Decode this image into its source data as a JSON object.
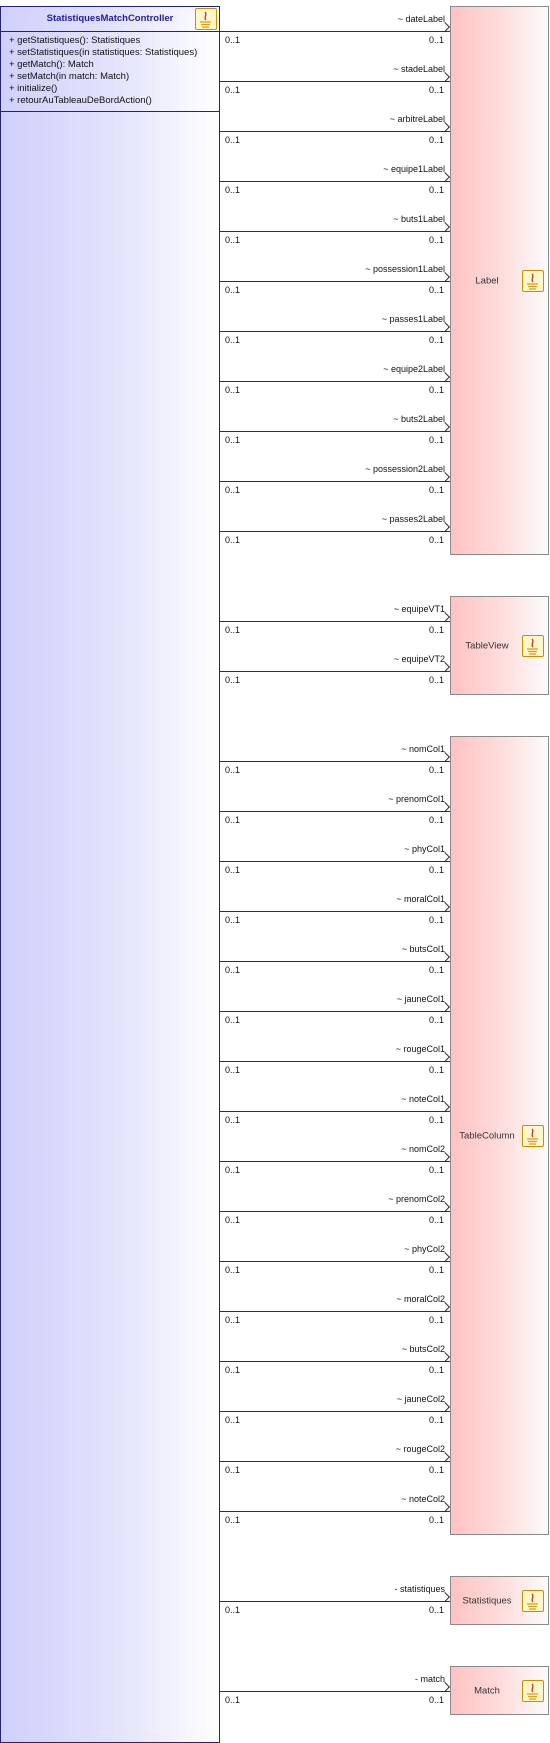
{
  "source_class": {
    "name": "StatistiquesMatchController",
    "methods": [
      "+ getStatistiques(): Statistiques",
      "+ setStatistiques(in statistiques: Statistiques)",
      "+ getMatch(): Match",
      "+ setMatch(in match: Match)",
      "+ initialize()",
      "+ retourAuTableauDeBordAction()"
    ],
    "icon": "java-class-icon"
  },
  "target_classes": [
    {
      "name": "Label",
      "icon": "java-class-icon"
    },
    {
      "name": "TableView",
      "icon": "java-class-icon"
    },
    {
      "name": "TableColumn",
      "icon": "java-class-icon"
    },
    {
      "name": "Statistiques",
      "icon": "java-class-icon"
    },
    {
      "name": "Match",
      "icon": "java-class-icon"
    }
  ],
  "associations": [
    {
      "role": "~ dateLabel",
      "source_mult": "0..1",
      "target_mult": "0..1",
      "target": "Label"
    },
    {
      "role": "~ stadeLabel",
      "source_mult": "0..1",
      "target_mult": "0..1",
      "target": "Label"
    },
    {
      "role": "~ arbitreLabel",
      "source_mult": "0..1",
      "target_mult": "0..1",
      "target": "Label"
    },
    {
      "role": "~ equipe1Label",
      "source_mult": "0..1",
      "target_mult": "0..1",
      "target": "Label"
    },
    {
      "role": "~ buts1Label",
      "source_mult": "0..1",
      "target_mult": "0..1",
      "target": "Label"
    },
    {
      "role": "~ possession1Label",
      "source_mult": "0..1",
      "target_mult": "0..1",
      "target": "Label"
    },
    {
      "role": "~ passes1Label",
      "source_mult": "0..1",
      "target_mult": "0..1",
      "target": "Label"
    },
    {
      "role": "~ equipe2Label",
      "source_mult": "0..1",
      "target_mult": "0..1",
      "target": "Label"
    },
    {
      "role": "~ buts2Label",
      "source_mult": "0..1",
      "target_mult": "0..1",
      "target": "Label"
    },
    {
      "role": "~ possession2Label",
      "source_mult": "0..1",
      "target_mult": "0..1",
      "target": "Label"
    },
    {
      "role": "~ passes2Label",
      "source_mult": "0..1",
      "target_mult": "0..1",
      "target": "Label"
    },
    {
      "role": "~ equipeVT1",
      "source_mult": "0..1",
      "target_mult": "0..1",
      "target": "TableView"
    },
    {
      "role": "~ equipeVT2",
      "source_mult": "0..1",
      "target_mult": "0..1",
      "target": "TableView"
    },
    {
      "role": "~ nomCol1",
      "source_mult": "0..1",
      "target_mult": "0..1",
      "target": "TableColumn"
    },
    {
      "role": "~ prenomCol1",
      "source_mult": "0..1",
      "target_mult": "0..1",
      "target": "TableColumn"
    },
    {
      "role": "~ phyCol1",
      "source_mult": "0..1",
      "target_mult": "0..1",
      "target": "TableColumn"
    },
    {
      "role": "~ moralCol1",
      "source_mult": "0..1",
      "target_mult": "0..1",
      "target": "TableColumn"
    },
    {
      "role": "~ butsCol1",
      "source_mult": "0..1",
      "target_mult": "0..1",
      "target": "TableColumn"
    },
    {
      "role": "~ jauneCol1",
      "source_mult": "0..1",
      "target_mult": "0..1",
      "target": "TableColumn"
    },
    {
      "role": "~ rougeCol1",
      "source_mult": "0..1",
      "target_mult": "0..1",
      "target": "TableColumn"
    },
    {
      "role": "~ noteCol1",
      "source_mult": "0..1",
      "target_mult": "0..1",
      "target": "TableColumn"
    },
    {
      "role": "~ nomCol2",
      "source_mult": "0..1",
      "target_mult": "0..1",
      "target": "TableColumn"
    },
    {
      "role": "~ prenomCol2",
      "source_mult": "0..1",
      "target_mult": "0..1",
      "target": "TableColumn"
    },
    {
      "role": "~ phyCol2",
      "source_mult": "0..1",
      "target_mult": "0..1",
      "target": "TableColumn"
    },
    {
      "role": "~ moralCol2",
      "source_mult": "0..1",
      "target_mult": "0..1",
      "target": "TableColumn"
    },
    {
      "role": "~ butsCol2",
      "source_mult": "0..1",
      "target_mult": "0..1",
      "target": "TableColumn"
    },
    {
      "role": "~ jauneCol2",
      "source_mult": "0..1",
      "target_mult": "0..1",
      "target": "TableColumn"
    },
    {
      "role": "~ rougeCol2",
      "source_mult": "0..1",
      "target_mult": "0..1",
      "target": "TableColumn"
    },
    {
      "role": "~ noteCol2",
      "source_mult": "0..1",
      "target_mult": "0..1",
      "target": "TableColumn"
    },
    {
      "role": "- statistiques",
      "source_mult": "0..1",
      "target_mult": "0..1",
      "target": "Statistiques"
    },
    {
      "role": "- match",
      "source_mult": "0..1",
      "target_mult": "0..1",
      "target": "Match"
    }
  ]
}
